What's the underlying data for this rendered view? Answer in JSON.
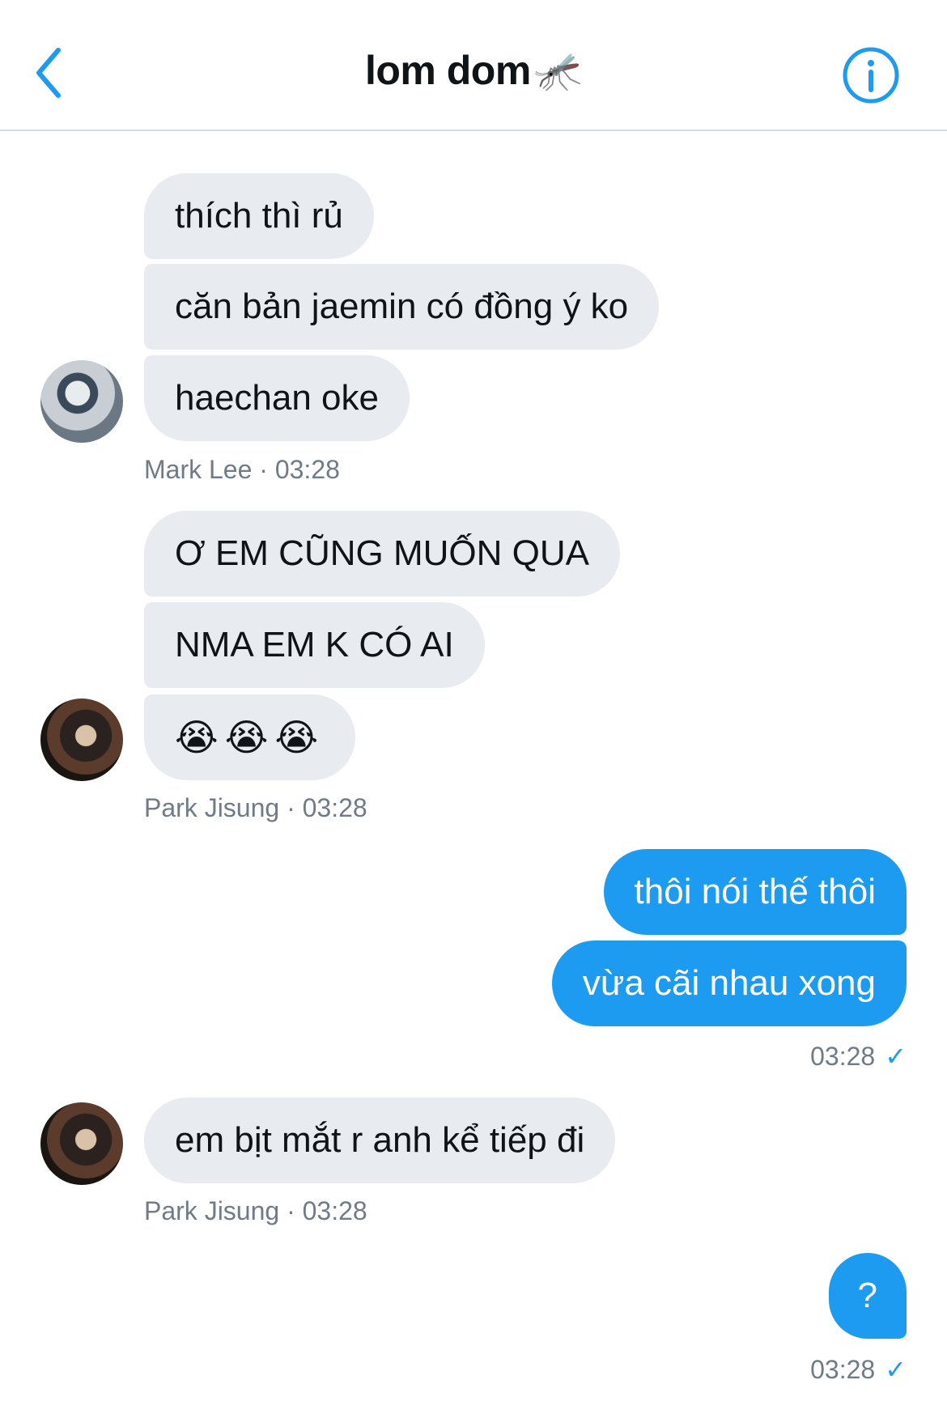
{
  "header": {
    "title": "lom dom",
    "title_emoji": "🦟"
  },
  "colors": {
    "accent": "#1d9bf0",
    "incoming_bubble": "#e8ebef",
    "meta_text": "#6f7b86"
  },
  "messages": [
    {
      "text": "thích thì rủ"
    },
    {
      "text": "căn bản jaemin có đồng ý ko"
    },
    {
      "text": "haechan oke"
    },
    {
      "meta": "Mark Lee · 03:28"
    },
    {
      "text": "Ơ EM CŨNG MUỐN QUA"
    },
    {
      "text": "NMA EM K CÓ AI"
    },
    {
      "text": "😭😭😭"
    },
    {
      "meta": "Park Jisung · 03:28"
    },
    {
      "text": "thôi nói thế thôi"
    },
    {
      "text": "vừa cãi nhau xong"
    },
    {
      "meta": "03:28"
    },
    {
      "text": "em bịt mắt r anh kể tiếp đi"
    },
    {
      "meta": "Park Jisung · 03:28"
    },
    {
      "text": "?"
    },
    {
      "meta": "03:28"
    }
  ],
  "check_mark": "✓"
}
